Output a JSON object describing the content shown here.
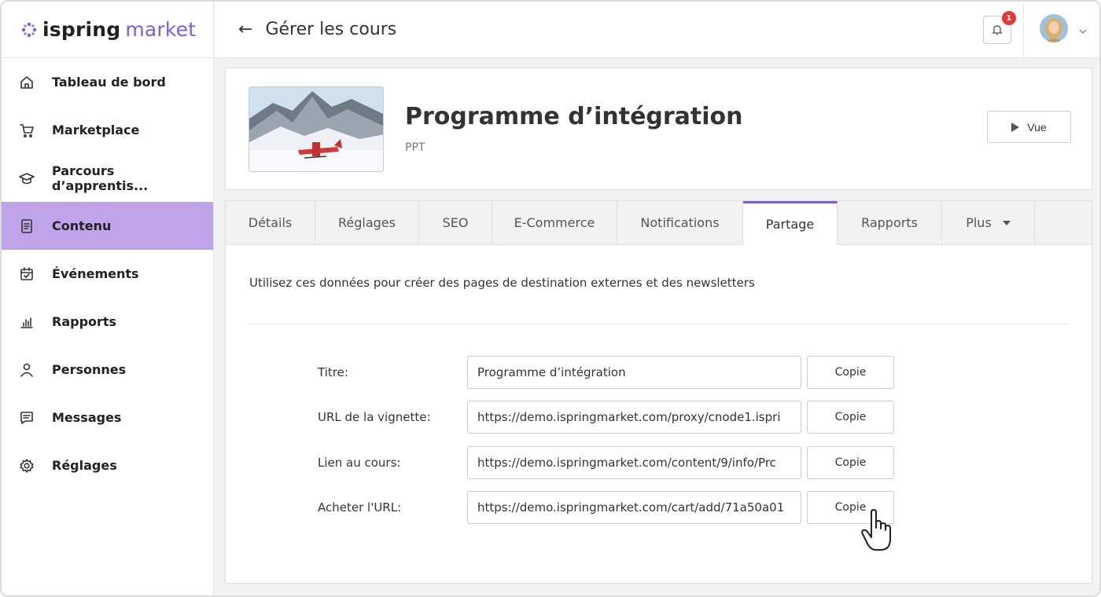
{
  "brand": {
    "part1": "ispring",
    "part2": "market",
    "accent": "#7c5ce0"
  },
  "header": {
    "back_icon": "arrow-left-icon",
    "title": "Gérer les cours",
    "notification_count": "1"
  },
  "sidebar": {
    "active_color": "#bfa4ea",
    "items": [
      {
        "label": "Tableau de bord",
        "icon": "home-icon"
      },
      {
        "label": "Marketplace",
        "icon": "cart-icon"
      },
      {
        "label": "Parcours d’apprentis...",
        "icon": "graduation-cap-icon"
      },
      {
        "label": "Contenu",
        "icon": "document-icon",
        "active": true
      },
      {
        "label": "Événements",
        "icon": "calendar-check-icon"
      },
      {
        "label": "Rapports",
        "icon": "bar-chart-icon"
      },
      {
        "label": "Personnes",
        "icon": "person-icon"
      },
      {
        "label": "Messages",
        "icon": "message-icon"
      },
      {
        "label": "Réglages",
        "icon": "gear-icon"
      }
    ]
  },
  "course": {
    "title": "Programme d’intégration",
    "type": "PPT",
    "view_label": "Vue"
  },
  "tabs": [
    "Détails",
    "Réglages",
    "SEO",
    "E-Commerce",
    "Notifications",
    "Partage",
    "Rapports",
    "Plus"
  ],
  "active_tab": "Partage",
  "share": {
    "description": "Utilisez ces données pour créer des pages de destination externes et des newsletters",
    "copy_label": "Copie",
    "rows": [
      {
        "label": "Titre:",
        "value": "Programme d’intégration"
      },
      {
        "label": "URL de la vignette:",
        "value": "https://demo.ispringmarket.com/proxy/cnode1.ispri"
      },
      {
        "label": "Lien au cours:",
        "value": "https://demo.ispringmarket.com/content/9/info/Prc"
      },
      {
        "label": "Acheter l'URL:",
        "value": "https://demo.ispringmarket.com/cart/add/71a50a01"
      }
    ]
  }
}
